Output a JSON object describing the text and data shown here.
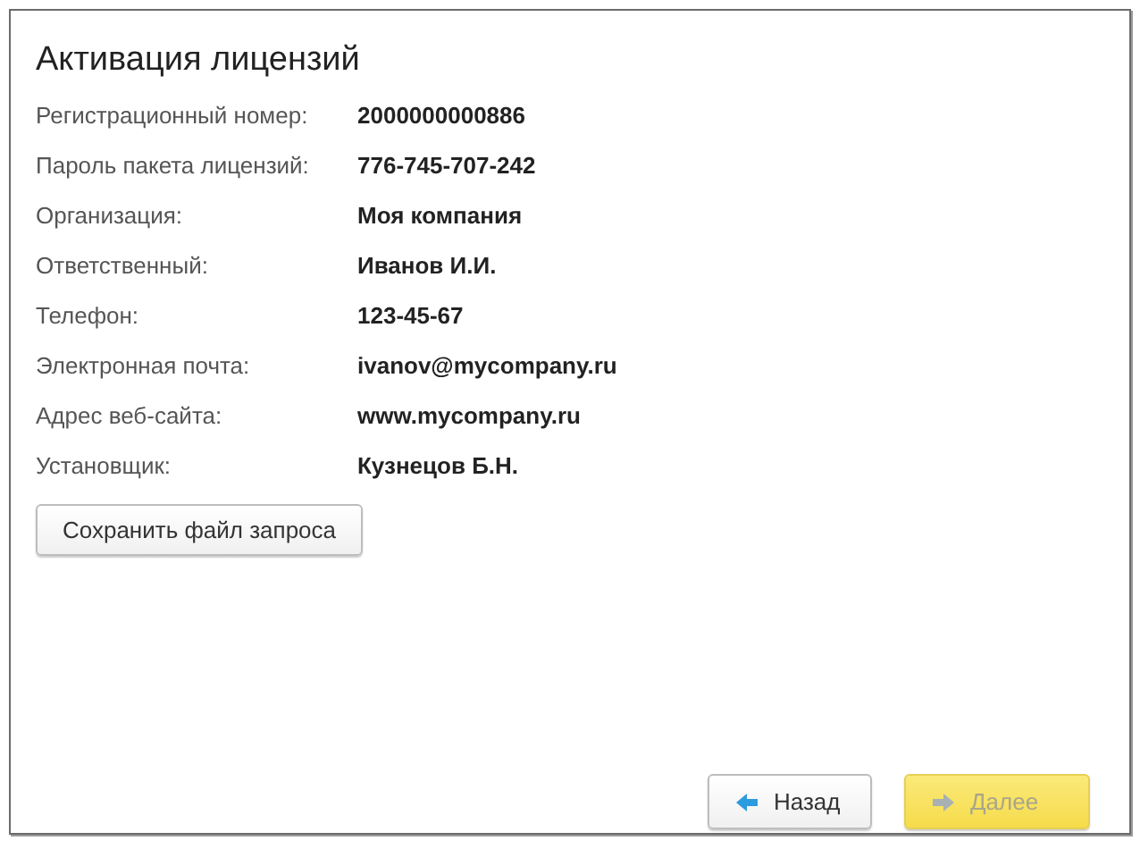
{
  "window": {
    "title": "Активация лицензий"
  },
  "fields": [
    {
      "label": "Регистрационный номер:",
      "value": "2000000000886"
    },
    {
      "label": "Пароль пакета лицензий:",
      "value": "776-745-707-242"
    },
    {
      "label": "Организация:",
      "value": "Моя компания"
    },
    {
      "label": "Ответственный:",
      "value": "Иванов И.И."
    },
    {
      "label": "Телефон:",
      "value": "123-45-67"
    },
    {
      "label": "Электронная почта:",
      "value": "ivanov@mycompany.ru"
    },
    {
      "label": "Адрес веб-сайта:",
      "value": "www.mycompany.ru"
    },
    {
      "label": "Установщик:",
      "value": "Кузнецов Б.Н."
    }
  ],
  "save_button": {
    "label": "Сохранить файл запроса"
  },
  "nav_buttons": [
    {
      "kind": "back",
      "label": "Назад",
      "disabled": false
    },
    {
      "kind": "next",
      "label": "Далее",
      "disabled": true
    }
  ]
}
